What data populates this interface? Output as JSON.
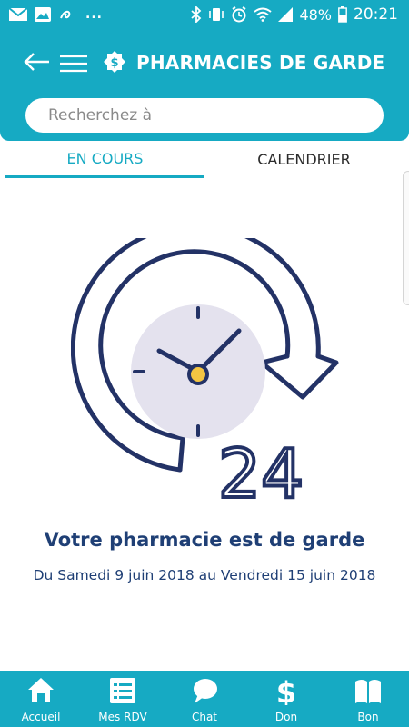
{
  "status_bar": {
    "overflow": "...",
    "battery": "48%",
    "time": "20:21"
  },
  "app_bar": {
    "title": "PHARMACIES DE GARDE"
  },
  "search": {
    "placeholder": "Recherchez à"
  },
  "tabs": [
    {
      "label": "EN COURS",
      "active": true
    },
    {
      "label": "CALENDRIER",
      "active": false
    }
  ],
  "illustration": {
    "number": "24"
  },
  "main": {
    "headline": "Votre pharmacie est de garde",
    "dates": "Du Samedi 9 juin 2018 au Vendredi 15 juin 2018"
  },
  "bottom_nav": [
    {
      "label": "Accueil",
      "icon": "home-icon"
    },
    {
      "label": "Mes RDV",
      "icon": "list-icon"
    },
    {
      "label": "Chat",
      "icon": "chat-bubble-icon"
    },
    {
      "label": "Don",
      "icon": "dollar-icon"
    },
    {
      "label": "Bon",
      "icon": "book-icon"
    }
  ],
  "colors": {
    "primary": "#16aac3",
    "navy": "#1f3f75",
    "clock_face": "#e4e2ee",
    "clock_center": "#f4c542"
  }
}
